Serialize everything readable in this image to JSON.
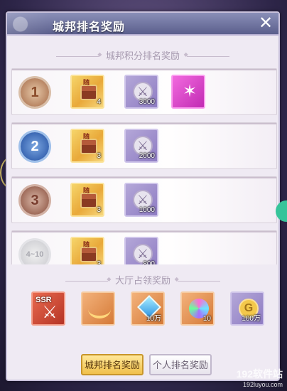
{
  "header": {
    "title": "城邦排名奖励",
    "close_icon": "close-icon"
  },
  "sections": {
    "city_rank_title": "城邦积分排名奖励",
    "hall_title": "大厅占领奖励"
  },
  "rank_rows": [
    {
      "rank_label": "1",
      "items": [
        {
          "icon": "treasure-chest-icon",
          "qty": "4",
          "style": "gold"
        },
        {
          "icon": "sword-medal-icon",
          "qty": "3000",
          "style": "purple"
        },
        {
          "icon": "magenta-rune-icon",
          "qty": "",
          "style": "magenta"
        }
      ]
    },
    {
      "rank_label": "2",
      "items": [
        {
          "icon": "treasure-chest-icon",
          "qty": "3",
          "style": "gold"
        },
        {
          "icon": "sword-medal-icon",
          "qty": "2000",
          "style": "purple"
        }
      ]
    },
    {
      "rank_label": "3",
      "items": [
        {
          "icon": "treasure-chest-icon",
          "qty": "3",
          "style": "gold"
        },
        {
          "icon": "sword-medal-icon",
          "qty": "1000",
          "style": "purple"
        }
      ]
    },
    {
      "rank_label": "4~10",
      "items": [
        {
          "icon": "treasure-chest-icon",
          "qty": "3",
          "style": "gold"
        },
        {
          "icon": "sword-medal-icon",
          "qty": "800",
          "style": "purple"
        }
      ]
    }
  ],
  "hall_items": [
    {
      "icon": "ssr-weapon-card-icon",
      "label": "SSR",
      "qty": "",
      "style": "red"
    },
    {
      "icon": "necklace-icon",
      "qty": "",
      "style": "orange"
    },
    {
      "icon": "diamond-icon",
      "qty": "10万",
      "style": "orange"
    },
    {
      "icon": "rainbow-gem-icon",
      "qty": "10",
      "style": "orange"
    },
    {
      "icon": "gold-coin-icon",
      "qty": "100万",
      "style": "purple"
    }
  ],
  "tabs": [
    {
      "label": "城邦排名奖励",
      "active": true
    },
    {
      "label": "个人排名奖励",
      "active": false
    }
  ],
  "watermark": {
    "brand": "192软件站",
    "url": "192luyou.com"
  }
}
